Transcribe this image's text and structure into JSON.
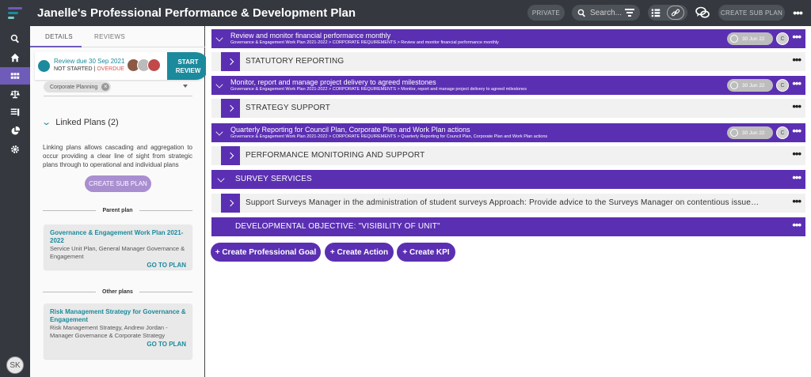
{
  "colors": {
    "purple": "#5b2fb2",
    "teal": "#1b8a9c",
    "dark": "#35393f",
    "overdue": "#d9534f"
  },
  "header": {
    "title": "Janelle's Professional Performance & Development Plan",
    "private_label": "PRIVATE",
    "search_placeholder": "Search...",
    "create_sub_plan_label": "CREATE SUB PLAN"
  },
  "rail": {
    "user_initials": "SK",
    "icons": [
      "search-icon",
      "home-icon",
      "grid-icon",
      "balance-icon",
      "list-icon",
      "pie-chart-icon",
      "gear-icon"
    ]
  },
  "sidebar": {
    "tabs": [
      "DETAILS",
      "REVIEWS"
    ],
    "review": {
      "due": "Review due 30 Sep 2021",
      "status": "NOT STARTED",
      "separator": "|",
      "overdue": "OVERDUE",
      "start_button": "START REVIEW"
    },
    "chip": "Corporate Planning",
    "linked_title": "Linked Plans (2)",
    "linked_desc": "Linking plans allows cascading and aggregation to occur providing a clear line of sight from strategic plans through to operational and individual plans",
    "create_sub_plan": "CREATE SUB PLAN",
    "parent_label": "Parent plan",
    "parent": {
      "title": "Governance & Engagement Work Plan 2021-2022",
      "desc": "Service Unit Plan, General Manager Governance & Engagement",
      "go": "GO TO PLAN"
    },
    "other_label": "Other plans",
    "other": {
      "title": "Risk Management Strategy for Governance & Engagement",
      "desc": "Risk Management Strategy, Andrew Jordan - Manager Governance & Corporate Strategy",
      "go": "GO TO PLAN"
    }
  },
  "main": {
    "goals": [
      {
        "title": "Review and monitor financial performance monthly",
        "crumb": "Governance & Engagement Work Plan 2021-2022 > CORPORATE REQUIREMENTS > Review and monitor financial performance monthly",
        "date": "30 Jun 22",
        "avatar": "C",
        "child": "STATUTORY REPORTING"
      },
      {
        "title": "Monitor, report and manage project delivery to agreed milestones",
        "crumb": "Governance & Engagement Work Plan 2021-2022 > CORPORATE REQUIREMENTS > Monitor, report and manage project delivery to agreed milestones",
        "date": "30 Jun 22",
        "avatar": "C",
        "child": "STRATEGY SUPPORT"
      },
      {
        "title": "Quarterly Reporting for Council Plan, Corporate Plan and Work Plan actions",
        "crumb": "Governance & Engagement Work Plan 2021-2022 > CORPORATE REQUIREMENTS > Quarterly Reporting for Council Plan, Corporate Plan and Work Plan actions",
        "date": "30 Jun 22",
        "avatar": "C",
        "child": "PERFORMANCE MONITORING AND SUPPORT"
      }
    ],
    "survey_title": "SURVEY SERVICES",
    "survey_child": "Support Surveys Manager in the administration of student surveys Approach: Provide advice to the Surveys Manager on contentious issues and nonroutine matters",
    "dev_objective": "DEVELOPMENTAL OBJECTIVE: \"VISIBILITY OF UNIT\"",
    "buttons": [
      "+ Create Professional Goal",
      "+ Create Action",
      "+ Create KPI"
    ]
  }
}
